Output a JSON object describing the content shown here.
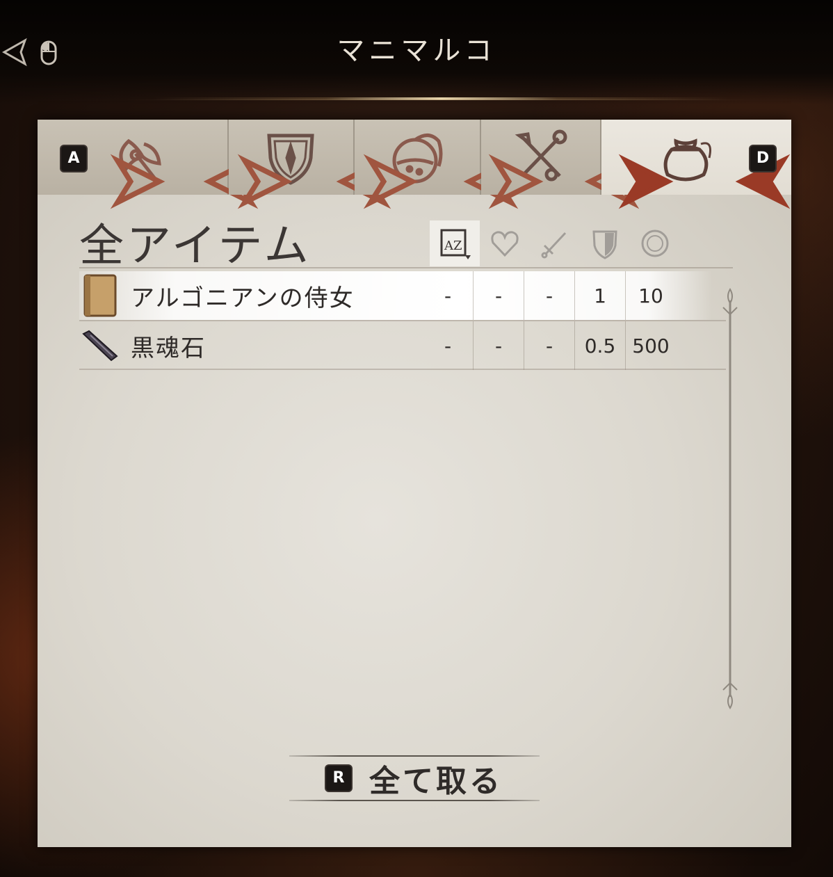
{
  "header": {
    "title": "マニマルコ"
  },
  "tabs": [
    {
      "name": "weapons",
      "icon": "axe-icon"
    },
    {
      "name": "armor",
      "icon": "shield-icon"
    },
    {
      "name": "potions",
      "icon": "potion-icon"
    },
    {
      "name": "misc",
      "icon": "key-icon"
    },
    {
      "name": "ingredients",
      "icon": "bag-icon",
      "active": true
    }
  ],
  "tab_keys": {
    "prev": "A",
    "next": "D"
  },
  "section": {
    "title": "全アイテム"
  },
  "columns": [
    "name-sort-icon",
    "health-icon",
    "damage-icon",
    "weight-icon",
    "value-icon"
  ],
  "items": [
    {
      "name": "アルゴニアンの侍女",
      "icon": "book-icon",
      "health": "-",
      "damage": "-",
      "armor": "-",
      "weight": "1",
      "value": "10",
      "selected": true
    },
    {
      "name": "黒魂石",
      "icon": "soul-gem-icon",
      "health": "-",
      "damage": "-",
      "armor": "-",
      "weight": "0.5",
      "value": "500",
      "selected": false
    }
  ],
  "take_all": {
    "key": "R",
    "label": "全て取る"
  }
}
